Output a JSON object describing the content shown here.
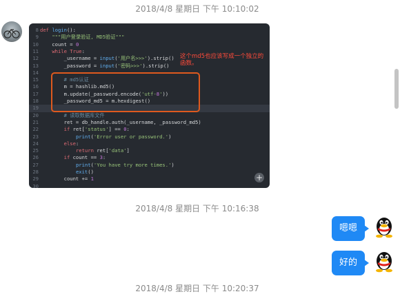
{
  "timestamps": [
    "2018/4/8 星期日 下午 10:10:02",
    "2018/4/8 星期日 下午 10:16:38",
    "2018/4/8 星期日 下午 10:20:37"
  ],
  "code_screenshot": {
    "annotation": "这个md5也应该写成一个独立的函数。",
    "current_line": 19,
    "lines": [
      {
        "n": "8",
        "t": "def login():"
      },
      {
        "n": "9",
        "t": "    \"\"\"用户登录验证, MD5验证\"\"\""
      },
      {
        "n": "10",
        "t": "    count = 0"
      },
      {
        "n": "11",
        "t": "    while True:"
      },
      {
        "n": "12",
        "t": "        _username = input('用户名>>>').strip()"
      },
      {
        "n": "13",
        "t": "        _password = input('密码>>>').strip()"
      },
      {
        "n": "14",
        "t": ""
      },
      {
        "n": "15",
        "t": "        # md5认证"
      },
      {
        "n": "16",
        "t": "        m = hashlib.md5()"
      },
      {
        "n": "17",
        "t": "        m.update(_password.encode('utf-8'))"
      },
      {
        "n": "18",
        "t": "        _password_md5 = m.hexdigest()"
      },
      {
        "n": "19",
        "t": ""
      },
      {
        "n": "20",
        "t": "        # 读取数据库文件"
      },
      {
        "n": "21",
        "t": "        ret = db_handle.auth(_username, _password_md5)"
      },
      {
        "n": "22",
        "t": "        if ret['status'] == 0:"
      },
      {
        "n": "23",
        "t": "            print('Error user or password.')"
      },
      {
        "n": "24",
        "t": "        else:"
      },
      {
        "n": "25",
        "t": "            return ret['data']"
      },
      {
        "n": "26",
        "t": "        if count == 3:"
      },
      {
        "n": "27",
        "t": "            print('You have try more times.')"
      },
      {
        "n": "28",
        "t": "            exit()"
      },
      {
        "n": "29",
        "t": "        count += 1"
      },
      {
        "n": "30",
        "t": ""
      }
    ],
    "expand_icon": "+"
  },
  "messages": [
    {
      "text": "嗯嗯"
    },
    {
      "text": "好的"
    }
  ],
  "colors": {
    "bubble": "#1f89f5",
    "annotation": "#ff4b3a",
    "highlight_box": "#e05a1e",
    "editor_bg": "#262a30"
  }
}
